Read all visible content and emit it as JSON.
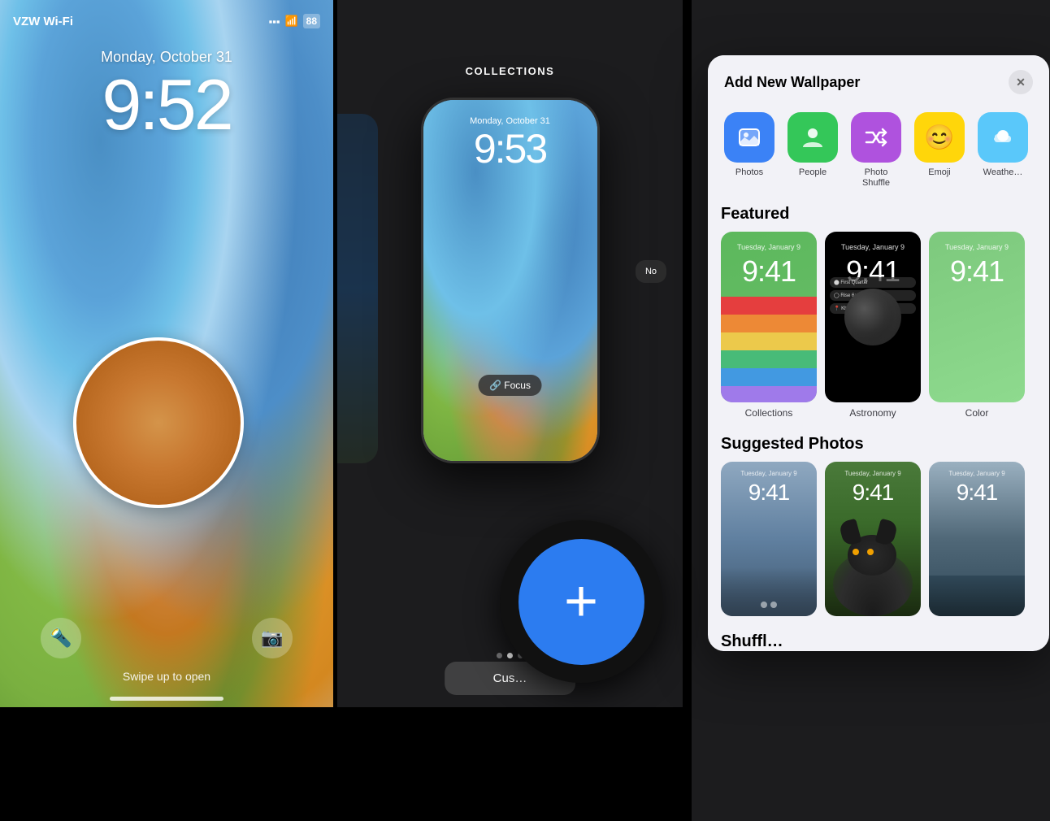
{
  "left": {
    "carrier": "VZW Wi-Fi",
    "battery": "88",
    "date": "Monday, October 31",
    "time": "9:52",
    "swipe_text": "Swipe up to open"
  },
  "middle": {
    "header": "COLLECTIONS",
    "phone_date": "Monday, October 31",
    "phone_time": "9:53",
    "focus_label": "🔗 Focus",
    "customize_label": "Cus…"
  },
  "right": {
    "modal_title": "Add New Wallpaper",
    "close_label": "✕",
    "categories": [
      {
        "id": "photos",
        "label": "Photos",
        "icon": "🖼️"
      },
      {
        "id": "people",
        "label": "People",
        "icon": "👤"
      },
      {
        "id": "shuffle",
        "label": "Photo\nShuffle",
        "icon": "🔀"
      },
      {
        "id": "emoji",
        "label": "Emoji",
        "icon": "😊"
      },
      {
        "id": "weather",
        "label": "Weathe…",
        "icon": "🌤️"
      }
    ],
    "featured_label": "Featured",
    "featured_cards": [
      {
        "id": "collections",
        "label": "Collections",
        "clock": "9:41",
        "date": "Tuesday, January 9"
      },
      {
        "id": "astronomy",
        "label": "Astronomy",
        "clock": "9:41",
        "date": "Tuesday, January 9"
      },
      {
        "id": "color",
        "label": "Color",
        "clock": "9:41",
        "date": "Tuesday, January 9"
      }
    ],
    "suggested_label": "Suggested Photos",
    "suggested_cards": [
      {
        "id": "city",
        "clock": "9:41",
        "date": "Tuesday, January 9"
      },
      {
        "id": "dog",
        "clock": "9:41",
        "date": "Tuesday, January 9"
      },
      {
        "id": "water",
        "clock": "9:41",
        "date": "Tuesday, January 9"
      }
    ],
    "shuffle_label": "Shuffl…"
  },
  "plus_button": {
    "label": "+"
  }
}
